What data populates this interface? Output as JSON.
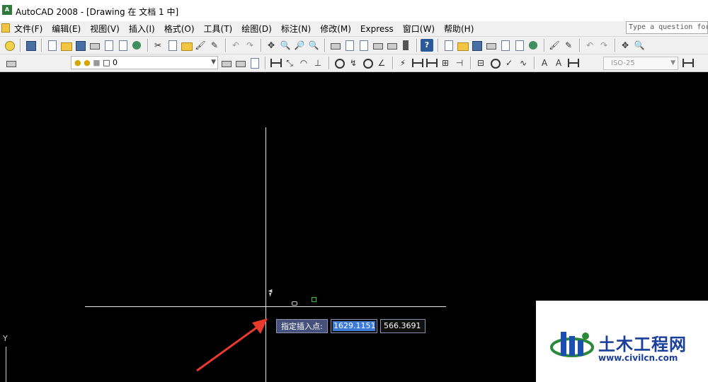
{
  "window": {
    "title": "AutoCAD 2008 - [Drawing 在 文档 1 中]"
  },
  "menu": {
    "items": [
      "文件(F)",
      "编辑(E)",
      "视图(V)",
      "插入(I)",
      "格式(O)",
      "工具(T)",
      "绘图(D)",
      "标注(N)",
      "修改(M)",
      "Express",
      "窗口(W)",
      "帮助(H)"
    ],
    "help_placeholder": "Type a question for"
  },
  "toolbar": {
    "layer_value": "0",
    "dim_style": "ISO-25"
  },
  "drawing": {
    "prompt_label": "指定插入点:",
    "coord_x": "1629.1151",
    "coord_y": "566.3691",
    "ucs_label": "Y"
  },
  "watermark": {
    "title": "土木工程网",
    "url": "www.civilcn.com"
  }
}
